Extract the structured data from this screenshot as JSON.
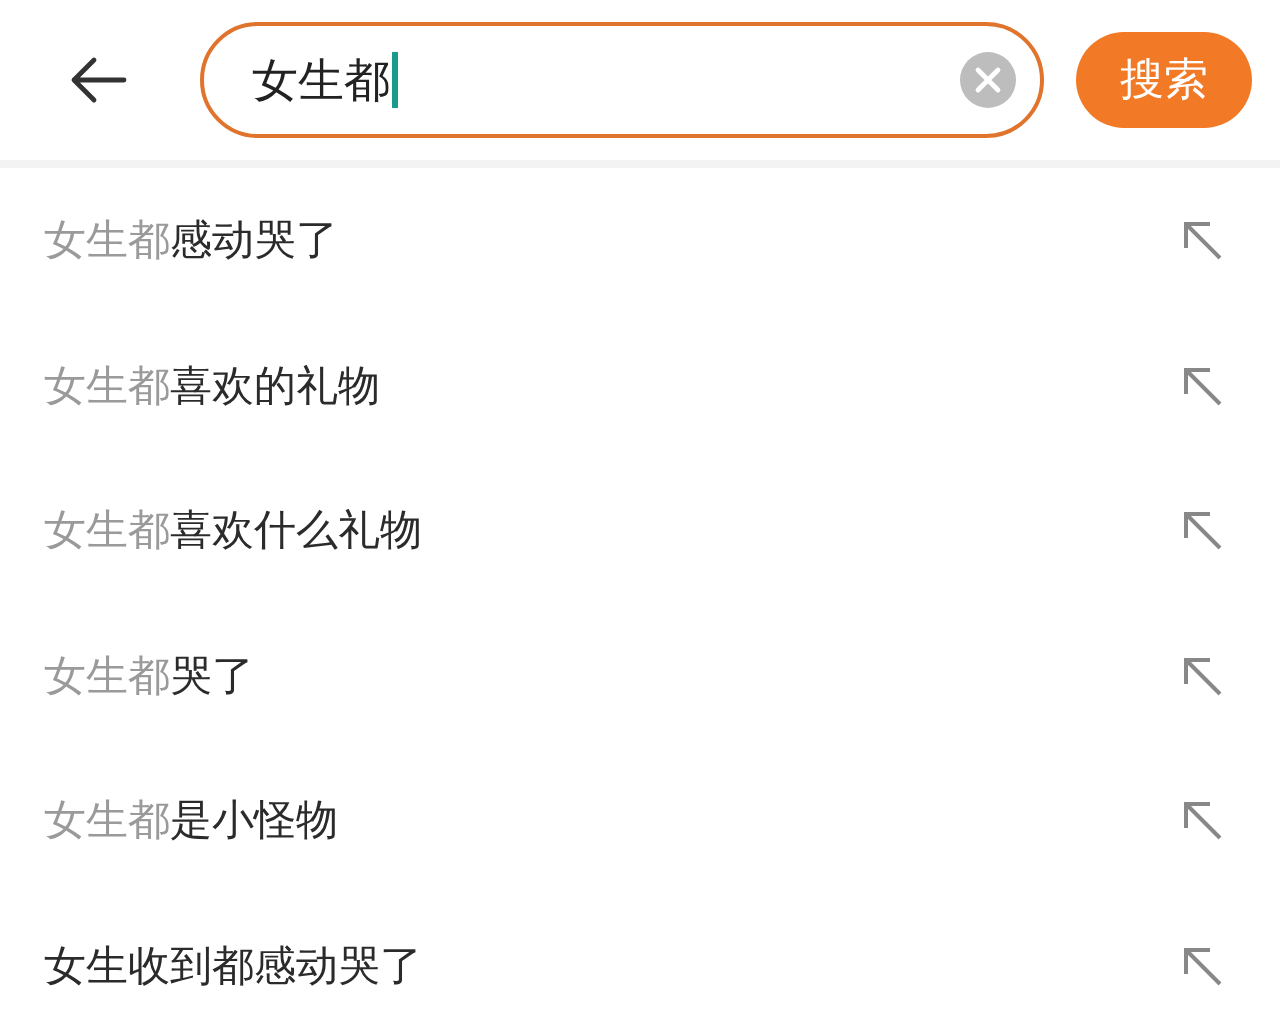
{
  "search": {
    "value": "女生都",
    "focused": true,
    "button": "搜索"
  },
  "suggestions": [
    {
      "parts": [
        {
          "text": "女生都",
          "matched": true
        },
        {
          "text": "感动哭了",
          "matched": false
        }
      ]
    },
    {
      "parts": [
        {
          "text": "女生都",
          "matched": true
        },
        {
          "text": "喜欢的礼物",
          "matched": false
        }
      ]
    },
    {
      "parts": [
        {
          "text": "女生都",
          "matched": true
        },
        {
          "text": "喜欢什么礼物",
          "matched": false
        }
      ]
    },
    {
      "parts": [
        {
          "text": "女生都",
          "matched": true
        },
        {
          "text": "哭了",
          "matched": false
        }
      ]
    },
    {
      "parts": [
        {
          "text": "女生都",
          "matched": true
        },
        {
          "text": "是小怪物",
          "matched": false
        }
      ]
    },
    {
      "parts": [
        {
          "text": "女生收到都感动哭了",
          "matched": false
        }
      ]
    }
  ]
}
